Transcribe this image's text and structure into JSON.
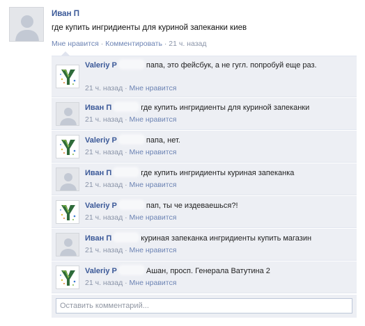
{
  "post": {
    "author": "Иван П",
    "text": "где купить ингридиенты для куриной запеканки киев",
    "like": "Мне нравится",
    "comment": "Комментировать",
    "time": "21 ч. назад",
    "sep": "·"
  },
  "comments": [
    {
      "author": "Valeriy P",
      "text": "папа, это фейсбук, а не гугл. попробуй еще раз.",
      "time": "21 ч. назад",
      "like": "Мне нравится",
      "avatar": "y-logo-icon"
    },
    {
      "author": "Иван П",
      "text": "где купить ингридиенты для куриной запеканки",
      "time": "21 ч. назад",
      "like": "Мне нравится",
      "avatar": "default-avatar-icon"
    },
    {
      "author": "Valeriy P",
      "text": "папа, нет.",
      "time": "21 ч. назад",
      "like": "Мне нравится",
      "avatar": "y-logo-icon"
    },
    {
      "author": "Иван П",
      "text": "где купить ингридиенты куриная запеканка",
      "time": "21 ч. назад",
      "like": "Мне нравится",
      "avatar": "default-avatar-icon"
    },
    {
      "author": "Valeriy P",
      "text": "пап, ты че издеваешься?!",
      "time": "21 ч. назад",
      "like": "Мне нравится",
      "avatar": "y-logo-icon"
    },
    {
      "author": "Иван П",
      "text": "куриная запеканка ингридиенты купить магазин",
      "time": "21 ч. назад",
      "like": "Мне нравится",
      "avatar": "default-avatar-icon"
    },
    {
      "author": "Valeriy P",
      "text": "Ашан, просп. Генерала Ватутина 2",
      "time": "21 ч. назад",
      "like": "Мне нравится",
      "avatar": "y-logo-icon"
    }
  ],
  "input": {
    "placeholder": "Оставить комментарий..."
  },
  "colors": {
    "link": "#3b5998",
    "comment_bg": "#edeff4",
    "meta": "#8a94a8"
  }
}
